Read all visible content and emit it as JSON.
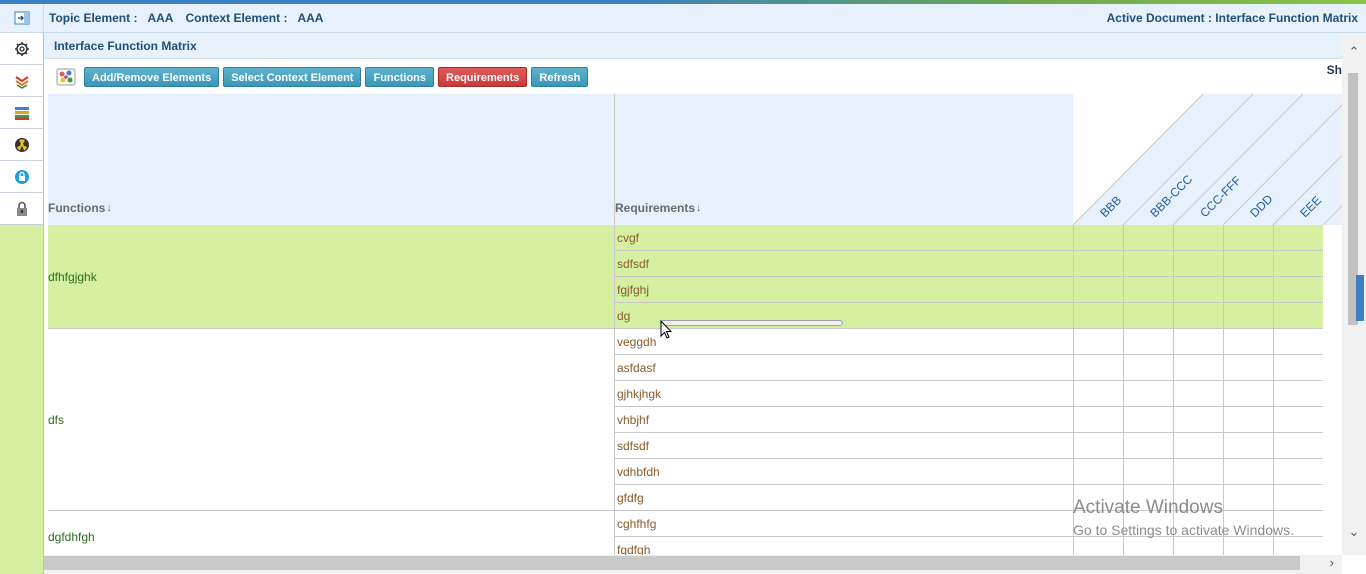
{
  "header": {
    "topic_label": "Topic Element :",
    "topic_value": "AAA",
    "context_label": "Context Element :",
    "context_value": "AAA",
    "active_document": "Active Document : Interface Function Matrix"
  },
  "sidebar": {
    "icons": [
      "gear-icon",
      "layers-icon",
      "books-icon",
      "hazard-icon",
      "lock-circle-icon",
      "padlock-icon"
    ]
  },
  "panel": {
    "title": "Interface Function Matrix"
  },
  "toolbar": {
    "add_remove": "Add/Remove Elements",
    "select_context": "Select Context Element",
    "functions": "Functions",
    "requirements": "Requirements",
    "refresh": "Refresh",
    "cut_off_text": "Sh"
  },
  "matrix": {
    "functions_header": "Functions",
    "requirements_header": "Requirements",
    "sort_icon": "↓",
    "columns": [
      "BBB",
      "BBB-CCC",
      "CCC-FFF",
      "DDD",
      "EEE"
    ],
    "groups": [
      {
        "function": "dfhfgjghk",
        "requirements": [
          "cvgf",
          "sdfsdf",
          "fgjfghj",
          "dg"
        ],
        "highlighted": true
      },
      {
        "function": "dfs",
        "requirements": [
          "veggdh",
          "asfdasf",
          "gjhkjhgk",
          "vhbjhf",
          "sdfsdf",
          "vdhbfdh",
          "gfdfg"
        ],
        "highlighted": false
      },
      {
        "function": "dgfdhfgh",
        "requirements": [
          "cghfhfg",
          "fgdfgh"
        ],
        "highlighted": false
      }
    ]
  },
  "watermark": {
    "line1": "Activate Windows",
    "line2": "Go to Settings to activate Windows."
  },
  "colors": {
    "highlight_row": "#d4f0a0",
    "header_bg": "#e6f1fb",
    "button_blue": "#3a97b8",
    "button_red": "#c83a3a"
  }
}
